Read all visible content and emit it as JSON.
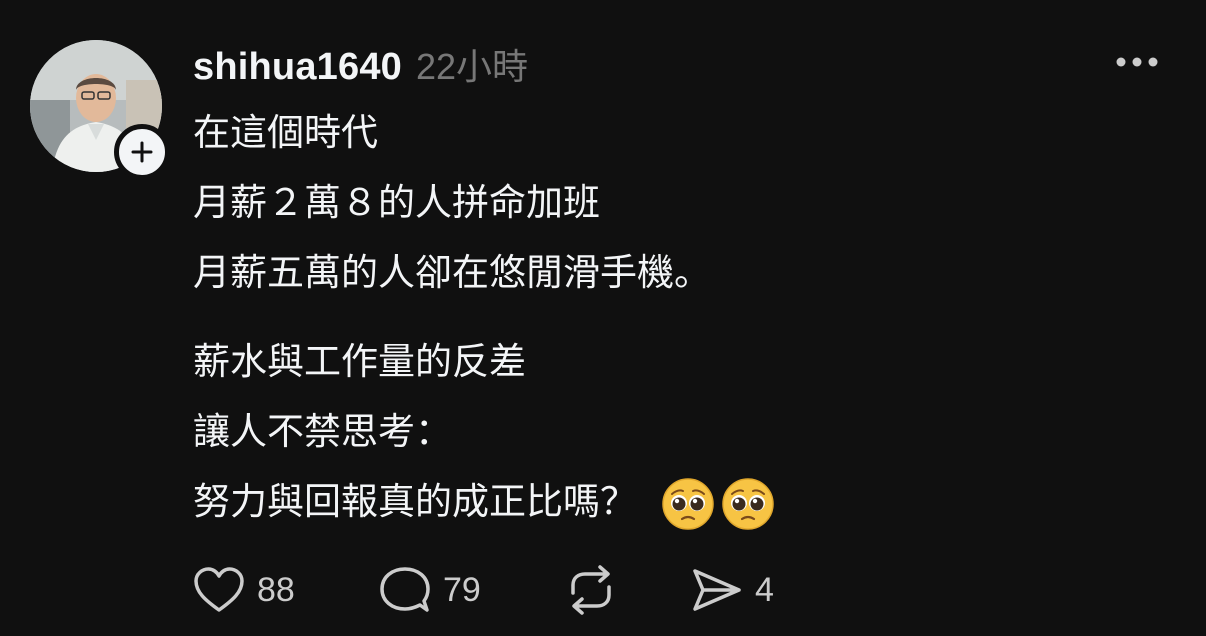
{
  "post": {
    "username": "shihua1640",
    "timestamp": "22小時",
    "paragraphs": [
      [
        "在這個時代",
        "月薪２萬８的人拼命加班",
        "月薪五萬的人卻在悠閒滑手機。"
      ],
      [
        "薪水與工作量的反差",
        "讓人不禁思考：",
        "努力與回報真的成正比嗎？"
      ]
    ],
    "emojis": [
      "pleading-face-emoji",
      "pleading-face-emoji"
    ]
  },
  "actions": {
    "likes": "88",
    "replies": "79",
    "shares": "4"
  },
  "colors": {
    "background": "#101010",
    "text": "#f3f5f7",
    "muted": "#777777"
  }
}
